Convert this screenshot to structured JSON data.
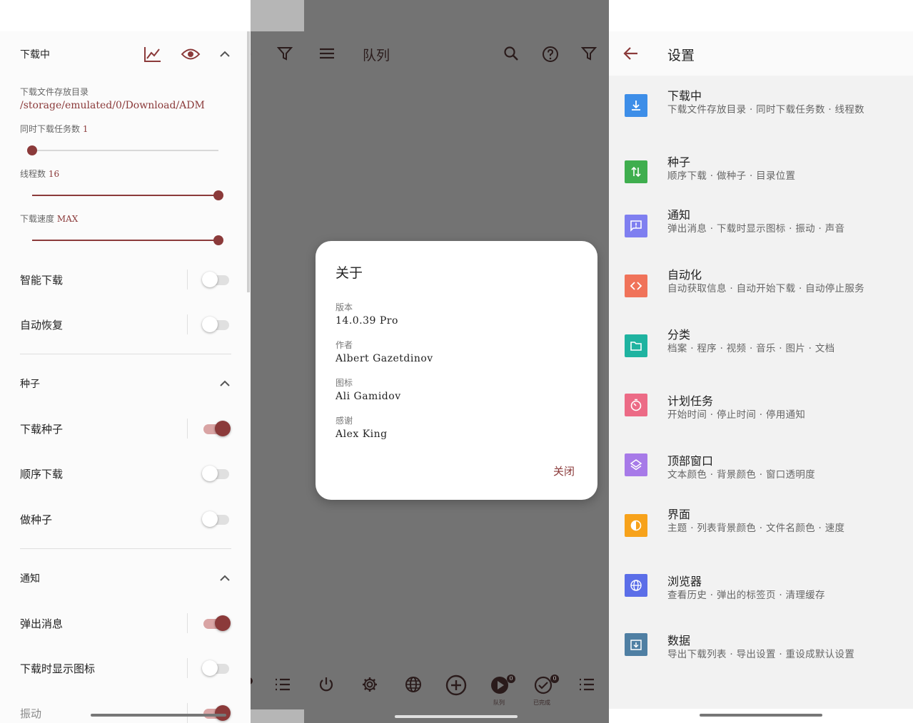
{
  "left": {
    "downloading": {
      "title": "下载中",
      "icons": [
        "chart-icon",
        "eye-icon",
        "chevron-up-icon"
      ],
      "dir_label": "下载文件存放目录",
      "dir_value": "/storage/emulated/0/Download/ADM",
      "tasks_label": "同时下载任务数",
      "tasks_value": "1",
      "tasks_level": 0.0,
      "threads_label": "线程数",
      "threads_value": "16",
      "threads_level": 1.0,
      "speed_label": "下载速度",
      "speed_value": "MAX",
      "speed_level": 1.0,
      "smart_label": "智能下载",
      "smart_on": false,
      "resume_label": "自动恢复",
      "resume_on": false
    },
    "torrent": {
      "title": "种子",
      "download_label": "下载种子",
      "download_on": true,
      "seq_label": "顺序下载",
      "seq_on": false,
      "seed_label": "做种子",
      "seed_on": false
    },
    "notify": {
      "title": "通知",
      "popup_label": "弹出消息",
      "popup_on": true,
      "showicon_label": "下载时显示图标",
      "showicon_on": false,
      "vibrate_label": "振动",
      "vibrate_on": true
    }
  },
  "middle": {
    "title": "队列",
    "top_icons": [
      "filter-icon",
      "menu-icon",
      "search-icon",
      "help-icon",
      "filter-icon"
    ],
    "bottom_nav": {
      "queue_label": "队列",
      "queue_badge": "0",
      "done_label": "已完成",
      "done_badge": "0"
    },
    "dialog": {
      "title": "关于",
      "version_label": "版本",
      "version_value": "14.0.39 Pro",
      "author_label": "作者",
      "author_value": "Albert Gazetdinov",
      "icon_label": "图标",
      "icon_value": "Ali Gamidov",
      "thanks_label": "感谢",
      "thanks_value": "Alex King",
      "close_label": "关闭"
    }
  },
  "right": {
    "title": "设置",
    "items": [
      {
        "title": "下载中",
        "sub": "下载文件存放目录 · 同时下载任务数 · 线程数",
        "color": "#3d8ee8",
        "icon": "download-icon"
      },
      {
        "title": "种子",
        "sub": "顺序下载 · 做种子 · 目录位置",
        "color": "#3fae4e",
        "icon": "swap-vertical-icon"
      },
      {
        "title": "通知",
        "sub": "弹出消息 · 下载时显示图标 · 振动 · 声音",
        "color": "#7f7ff0",
        "icon": "message-alert-icon"
      },
      {
        "title": "自动化",
        "sub": "自动获取信息 · 自动开始下载 · 自动停止服务",
        "color": "#f0735a",
        "icon": "code-icon"
      },
      {
        "title": "分类",
        "sub": "档案 · 程序 · 视频 · 音乐 · 图片 · 文档",
        "color": "#1fb3a0",
        "icon": "folder-icon"
      },
      {
        "title": "计划任务",
        "sub": "开始时间 · 停止时间 · 停用通知",
        "color": "#ec6b86",
        "icon": "timer-icon"
      },
      {
        "title": "顶部窗口",
        "sub": "文本颜色 · 背景颜色 · 窗口透明度",
        "color": "#a77ae8",
        "icon": "layers-icon"
      },
      {
        "title": "界面",
        "sub": "主题 · 列表背景颜色 · 文件名颜色 · 速度",
        "color": "#f7a21b",
        "icon": "contrast-icon"
      },
      {
        "title": "浏览器",
        "sub": "查看历史 · 弹出的标签页 · 清理缓存",
        "color": "#5b6ee8",
        "icon": "globe-icon"
      },
      {
        "title": "数据",
        "sub": "导出下载列表 · 导出设置 · 重设成默认设置",
        "color": "#4f7fa3",
        "icon": "archive-icon"
      }
    ]
  },
  "colors": {
    "accent": "#8b3a3a",
    "scrim": "#737373"
  }
}
